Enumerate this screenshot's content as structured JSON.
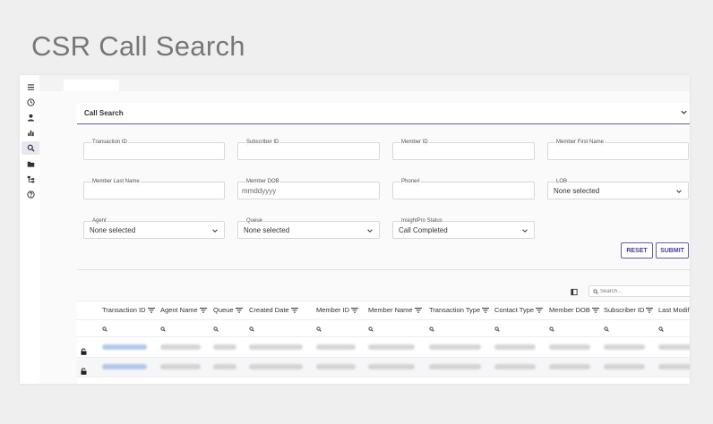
{
  "page_title": "CSR Call Search",
  "sidebar": {
    "icons": [
      "menu-icon",
      "clock-icon",
      "user-icon",
      "bar-chart-icon",
      "search-icon",
      "folder-icon",
      "hierarchy-icon",
      "help-icon"
    ],
    "active": "search-icon"
  },
  "panel": {
    "title": "Call Search"
  },
  "form": {
    "transaction_id": {
      "label": "Transaction ID",
      "value": ""
    },
    "subscriber_id": {
      "label": "Subscriber ID",
      "value": ""
    },
    "member_id": {
      "label": "Member ID",
      "value": ""
    },
    "member_first_name": {
      "label": "Member First Name",
      "value": ""
    },
    "member_last_name": {
      "label": "Member Last Name",
      "value": ""
    },
    "member_dob": {
      "label": "Member DOB",
      "placeholder": "mmddyyyy"
    },
    "phone": {
      "label": "Phone#",
      "value": ""
    },
    "lob": {
      "label": "LOB",
      "value": "None selected"
    },
    "agent": {
      "label": "Agent",
      "value": "None selected"
    },
    "queue": {
      "label": "Queue",
      "value": "None selected"
    },
    "insightpro_status": {
      "label": "InsightPro Status",
      "value": "Call Completed"
    }
  },
  "buttons": {
    "reset": "RESET",
    "submit": "SUBMIT"
  },
  "grid": {
    "search_placeholder": "Search...",
    "columns": [
      "Transaction ID",
      "Agent Name",
      "Queue",
      "Created Date",
      "Member ID",
      "Member Name",
      "Transaction Type",
      "Contact Type",
      "Member DOB",
      "Subscriber ID",
      "Last Modifie"
    ],
    "row_count": 2
  },
  "colors": {
    "accent": "#6a5aa8",
    "link": "#9ab8e3"
  }
}
